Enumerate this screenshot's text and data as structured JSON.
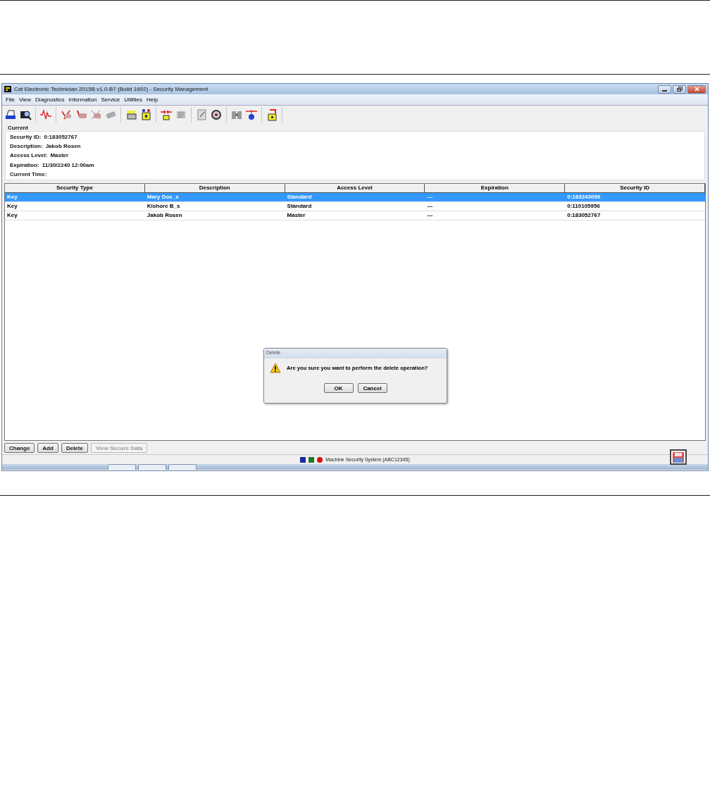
{
  "window": {
    "title": "Cat Electronic Technician 2015B v1.0-B7 (Build 1692) - Security Management"
  },
  "menu": [
    "File",
    "View",
    "Diagnostics",
    "Information",
    "Service",
    "Utilities",
    "Help"
  ],
  "current": {
    "heading": "Current",
    "fields": [
      {
        "label": "Security ID:",
        "value": "0:183052767"
      },
      {
        "label": "Description:",
        "value": "Jakob Rosen"
      },
      {
        "label": "Access Level:",
        "value": "Master"
      },
      {
        "label": "Expiration:",
        "value": "11/30/2240 12:00am"
      },
      {
        "label": "Current Time:"
      }
    ]
  },
  "table": {
    "columns": [
      "Security Type",
      "Description",
      "Access Level",
      "Expiration",
      "Security ID"
    ],
    "rows": [
      {
        "selected": true,
        "cells": [
          "Key",
          "Mary Doe_s",
          "Standard",
          "---",
          "0:183243096"
        ]
      },
      {
        "selected": false,
        "cells": [
          "Key",
          "Kishore B_s",
          "Standard",
          "---",
          "0:110105956"
        ]
      },
      {
        "selected": false,
        "cells": [
          "Key",
          "Jakob Rosen",
          "Master",
          "---",
          "0:183052767"
        ]
      }
    ]
  },
  "dialog": {
    "title": "Delete",
    "message": "Are you sure you want to perform the delete operation?",
    "buttons": [
      "OK",
      "Cancel"
    ]
  },
  "buttons": [
    {
      "label": "Change",
      "disabled": false
    },
    {
      "label": "Add",
      "disabled": false
    },
    {
      "label": "Delete",
      "disabled": false
    },
    {
      "label": "View Secure Data",
      "disabled": true
    }
  ],
  "status_bar": {
    "text": "Machine Security System (ABC12345)"
  }
}
